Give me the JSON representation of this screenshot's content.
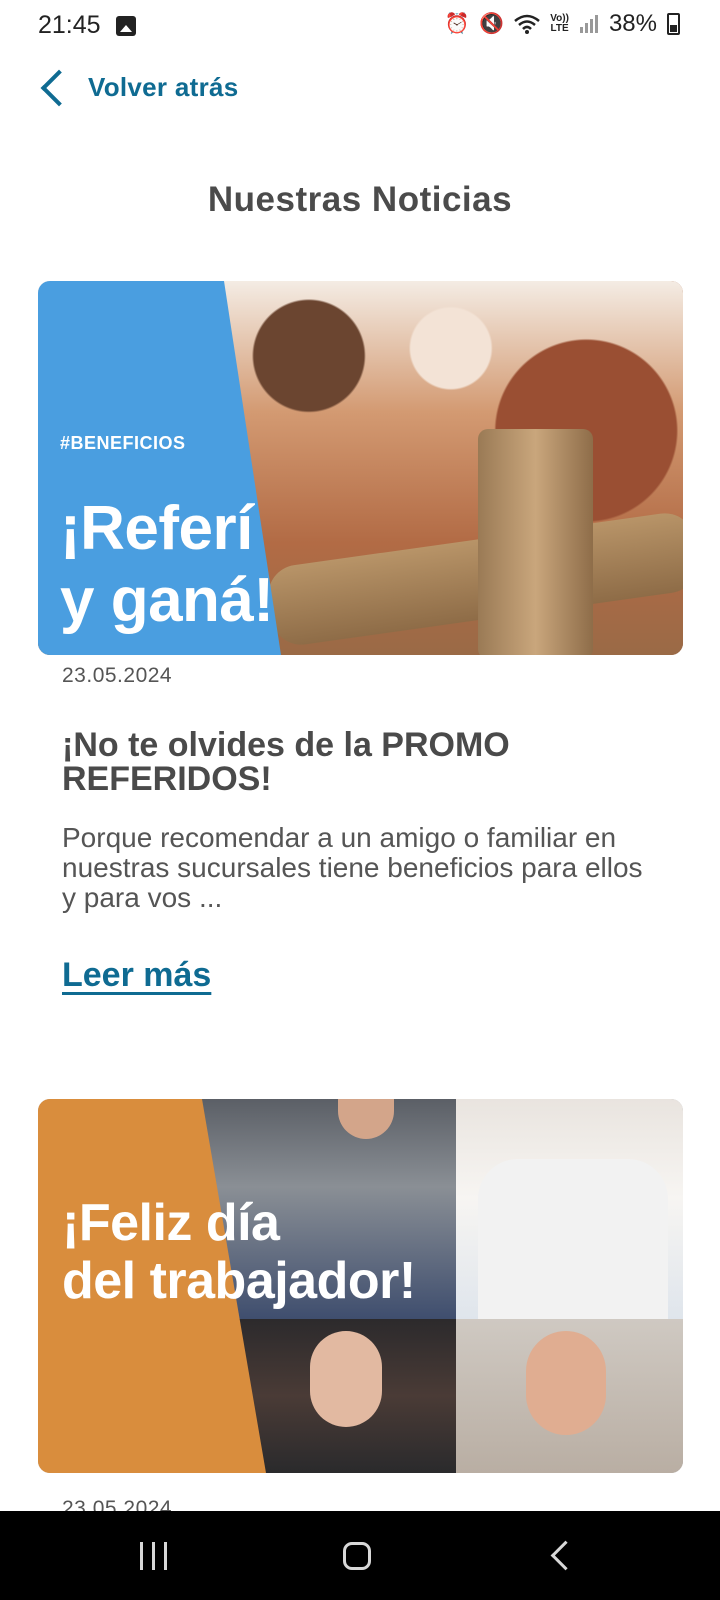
{
  "status_bar": {
    "time": "21:45",
    "battery": "38%",
    "icons": [
      "gallery-icon",
      "alarm-icon",
      "mute-icon",
      "wifi-icon",
      "volte-icon",
      "signal-icon",
      "battery-icon"
    ],
    "volte_label": "Vo))\nLTE"
  },
  "header": {
    "back_label": "Volver atrás"
  },
  "page_title": "Nuestras Noticias",
  "news": [
    {
      "image_hashtag": "#BENEFICIOS",
      "image_headline": "¡Referí\ny ganá!",
      "image_accent": "#4a9ee0",
      "date": "23.05.2024",
      "title": "¡No te olvides de la PROMO REFERIDOS!",
      "excerpt": "Porque recomendar a un amigo o familiar en nuestras sucursales tiene beneficios para ellos y para vos ...",
      "read_more": "Leer más"
    },
    {
      "image_headline": "¡Feliz día\ndel trabajador!",
      "image_accent": "#d98d3d",
      "date": "23.05.2024"
    }
  ],
  "colors": {
    "brand": "#0f6b92",
    "text": "#4a4a4a"
  }
}
